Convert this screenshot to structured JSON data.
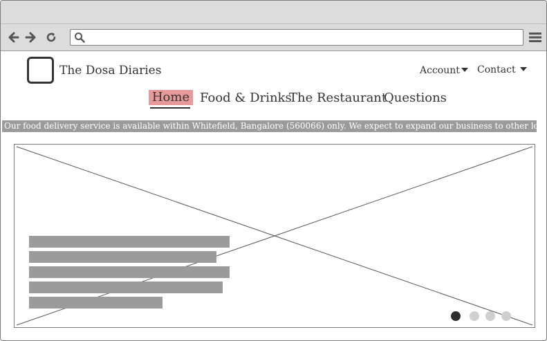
{
  "browser": {
    "address_value": "",
    "icons": [
      "back-arrow-icon",
      "forward-arrow-icon",
      "reload-icon",
      "search-icon",
      "hamburger-menu-icon"
    ]
  },
  "site": {
    "brand": "The Dosa Diaries",
    "top_links": [
      {
        "label": "Account"
      },
      {
        "label": "Contact"
      }
    ],
    "main_nav": [
      {
        "label": "Home",
        "active": true
      },
      {
        "label": "Food & Drinks"
      },
      {
        "label": "The Restaurant"
      },
      {
        "label": "Questions"
      }
    ],
    "ticker": "Our food delivery service is available within Whitefield, Bangalore (560066) only. We expect to expand our business  to other locations soon"
  },
  "carousel": {
    "slide_count": 4,
    "active_index": 0
  },
  "colors": {
    "active_nav_bg": "#e89a9a",
    "ticker_bg": "#9b9b9b",
    "chrome_bg": "#dcdcdc"
  }
}
